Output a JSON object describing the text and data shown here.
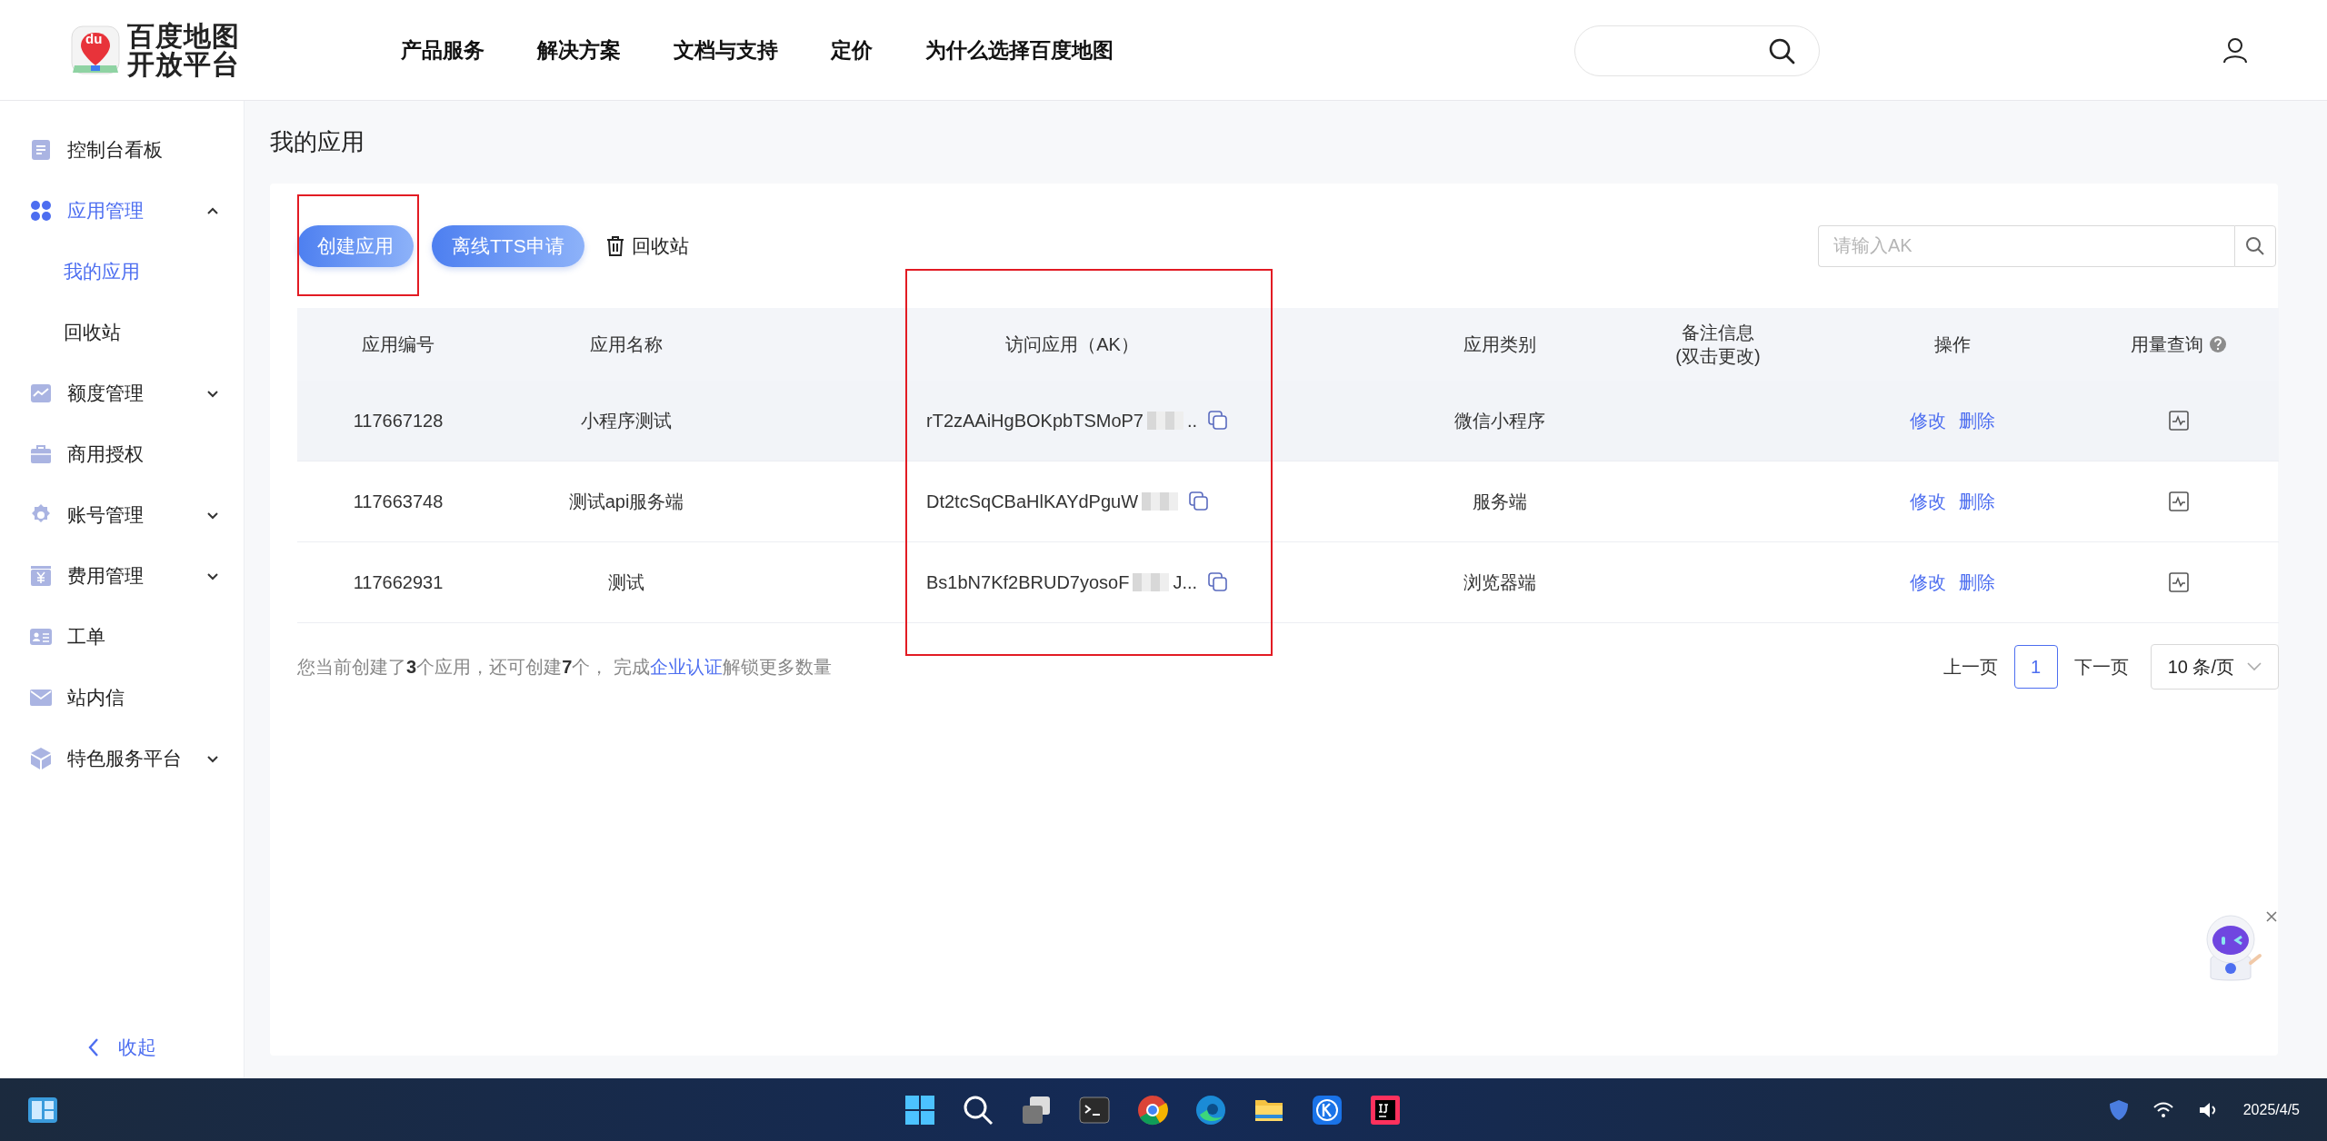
{
  "header": {
    "logo_badge": "du",
    "logo_lines": [
      "百度地图",
      "开放平台"
    ],
    "nav": [
      "产品服务",
      "解决方案",
      "文档与支持",
      "定价",
      "为什么选择百度地图"
    ]
  },
  "sidebar": {
    "items": [
      {
        "label": "控制台看板"
      },
      {
        "label": "应用管理",
        "expanded": true,
        "children": [
          {
            "label": "我的应用",
            "selected": true
          },
          {
            "label": "回收站",
            "selected": false
          }
        ]
      },
      {
        "label": "额度管理",
        "expanded": false
      },
      {
        "label": "商用授权"
      },
      {
        "label": "账号管理",
        "expanded": false
      },
      {
        "label": "费用管理",
        "expanded": false
      },
      {
        "label": "工单"
      },
      {
        "label": "站内信"
      },
      {
        "label": "特色服务平台",
        "expanded": false
      }
    ],
    "collapse": "收起"
  },
  "page_title": "我的应用",
  "toolbar": {
    "buttons": [
      "创建应用",
      "离线TTS申请"
    ],
    "recycle": "回收站",
    "search": {
      "placeholder": "请输入AK"
    }
  },
  "table": {
    "columns": [
      {
        "lines": [
          "应用编号"
        ]
      },
      {
        "lines": [
          "应用名称"
        ]
      },
      {
        "lines": [
          "访问应用（AK）"
        ]
      },
      {
        "lines": [
          "应用类别"
        ]
      },
      {
        "lines": [
          "备注信息",
          "(双击更改)"
        ]
      },
      {
        "lines": [
          "操作"
        ]
      },
      {
        "lines": [
          "用量查询"
        ],
        "help": true
      }
    ],
    "rows": [
      {
        "id": "117667128",
        "name": "小程序测试",
        "ak": "rT2zAAiHgBOKpbTSMoP7",
        "ak_tail": "..",
        "category": "微信小程序",
        "actions": [
          "修改",
          "删除"
        ],
        "highlighted": true
      },
      {
        "id": "117663748",
        "name": "测试api服务端",
        "ak": "Dt2tcSqCBaHlKAYdPguW",
        "category": "服务端",
        "actions": [
          "修改",
          "删除"
        ],
        "highlighted": false
      },
      {
        "id": "117662931",
        "name": "测试",
        "ak": "Bs1bN7Kf2BRUD7yosoF",
        "ak_tail": "J...",
        "category": "浏览器端",
        "actions": [
          "修改",
          "删除"
        ],
        "highlighted": false
      }
    ]
  },
  "footer": {
    "summary": "您当前创建了**3**个应用，还可创建**7**个， 完成",
    "link": "企业认证",
    "summary_end": "解锁更多数量"
  },
  "pagination": {
    "prev": "上一页",
    "pages": [
      {
        "label": "1",
        "selected": true
      }
    ],
    "next": "下一页",
    "page_size": "10 条/页"
  },
  "taskbar": {
    "date": "2025/4/5"
  }
}
